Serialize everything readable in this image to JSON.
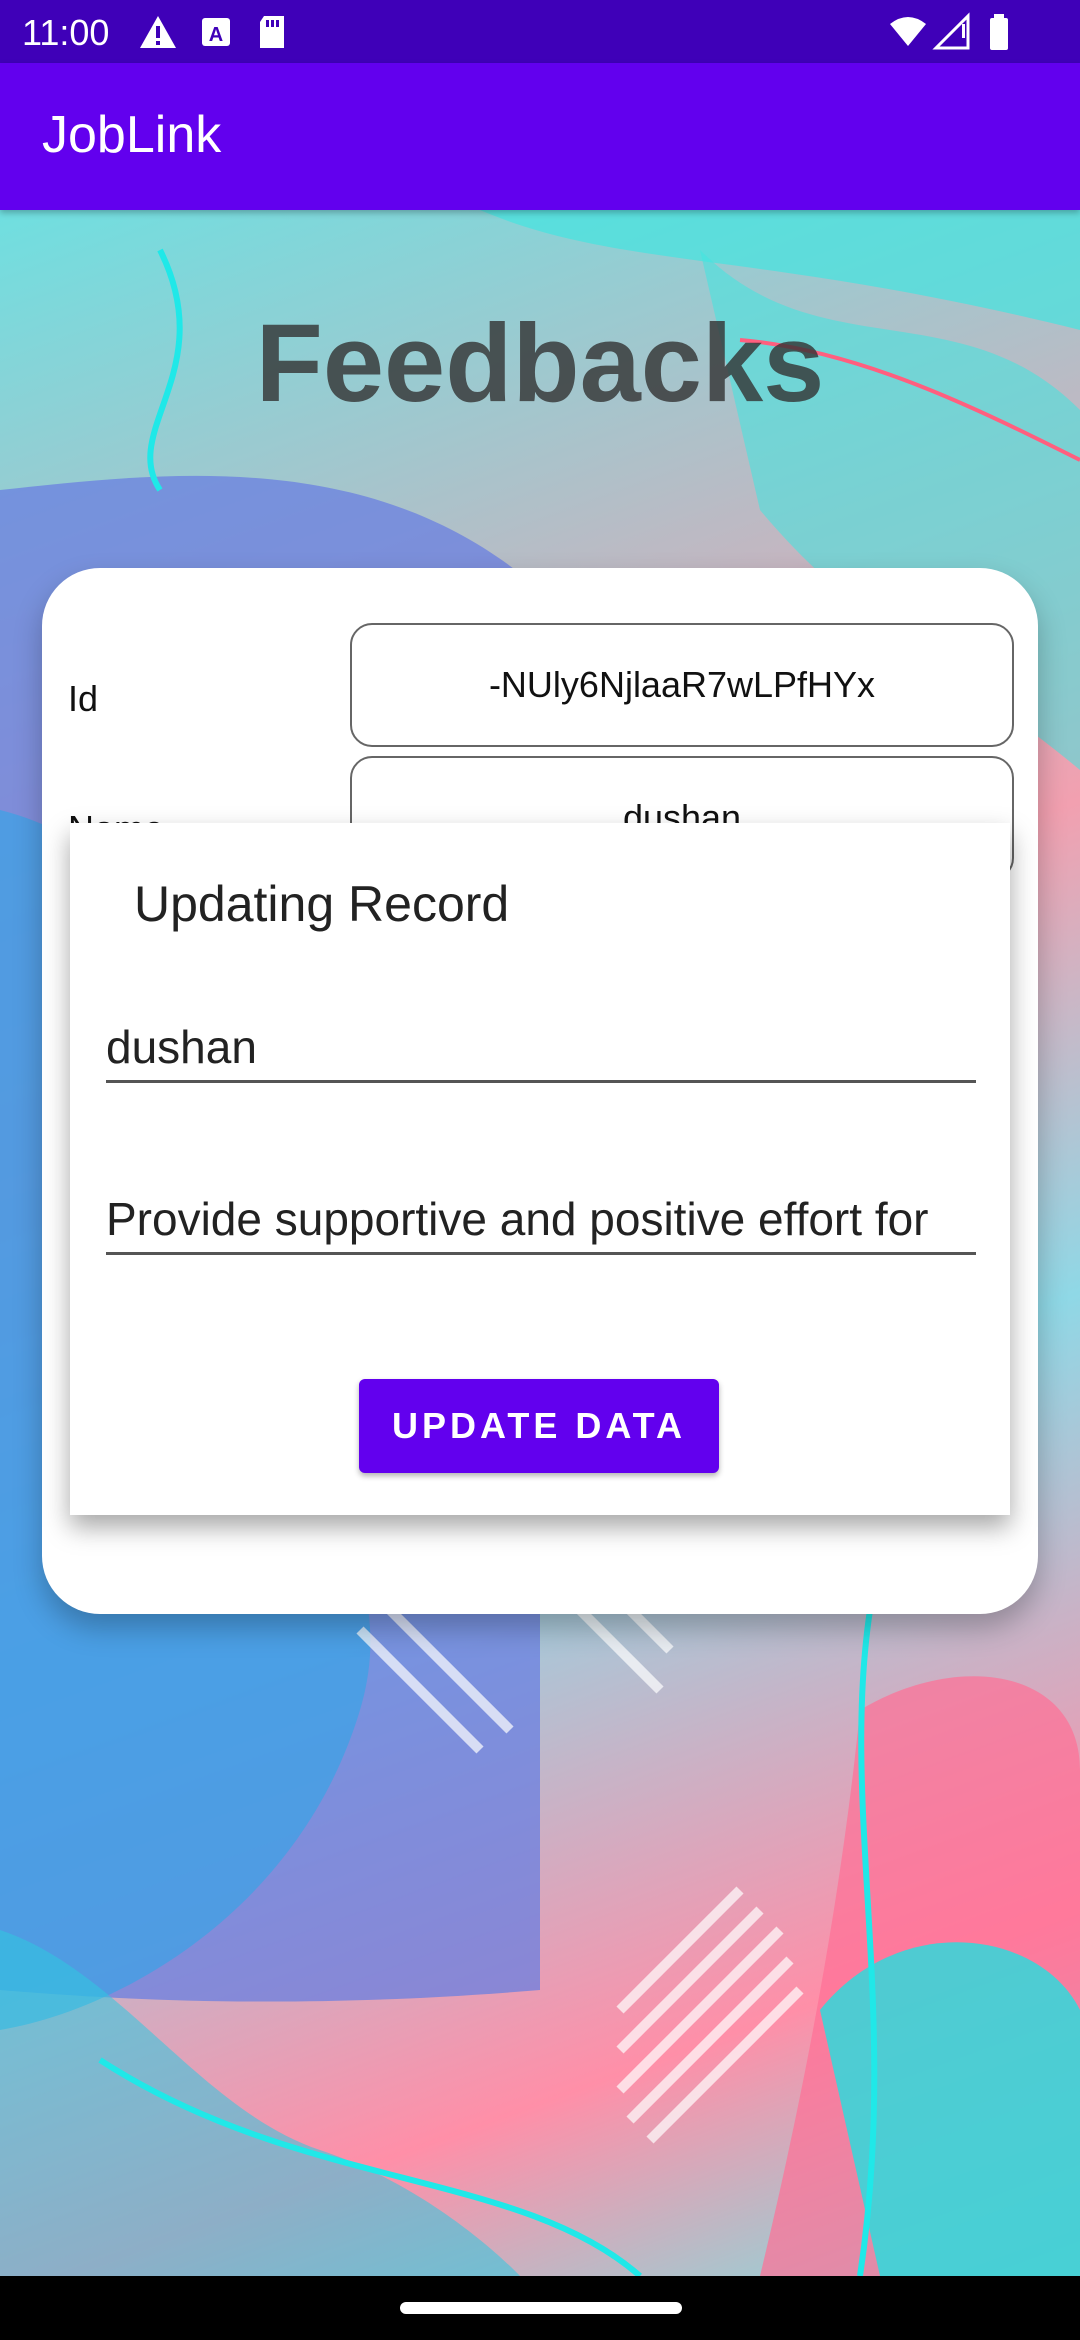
{
  "status_bar": {
    "time": "11:00",
    "left_icons": [
      "warning-icon",
      "text-a-icon",
      "sd-card-icon"
    ],
    "right_icons": [
      "wifi-icon",
      "signal-icon",
      "battery-icon"
    ]
  },
  "app_bar": {
    "title": "JobLink"
  },
  "page": {
    "title": "Feedbacks"
  },
  "record_form": {
    "id_label": "Id",
    "id_value": "-NUly6NjlaaR7wLPfHYx",
    "name_label": "Name",
    "name_value": "dushan"
  },
  "dialog": {
    "title": "Updating Record",
    "name_value": "dushan",
    "feedback_value": "Provide supportive and positive effort for",
    "update_button": "UPDATE DATA"
  },
  "colors": {
    "primary": "#6200ee",
    "status_bar": "#3f00b8"
  }
}
